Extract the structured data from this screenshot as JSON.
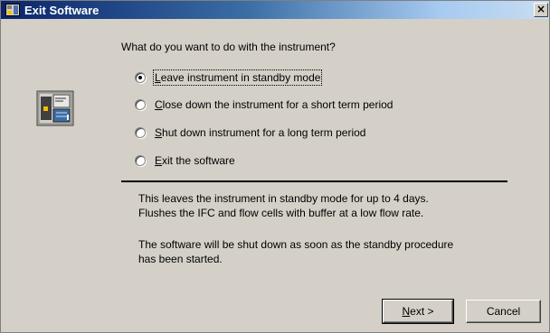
{
  "window": {
    "title": "Exit Software",
    "close_glyph": "×"
  },
  "prompt": "What do you want to do with the instrument?",
  "options": [
    {
      "hotkey": "L",
      "rest": "eave instrument in standby mode",
      "checked": true
    },
    {
      "hotkey": "C",
      "rest": "lose down the instrument for a short term period",
      "checked": false
    },
    {
      "hotkey": "S",
      "rest": "hut down instrument for a long term period",
      "checked": false
    },
    {
      "hotkey": "E",
      "rest": "xit the software",
      "checked": false
    }
  ],
  "description": {
    "line1": "This leaves the instrument in standby mode for up to 4 days.",
    "line2": "Flushes the IFC and flow cells with buffer at a low flow rate.",
    "line3": "The software will be shut down as soon as the standby procedure",
    "line4": "has been started."
  },
  "buttons": {
    "next_hotkey": "N",
    "next_rest": "ext >",
    "cancel": "Cancel"
  },
  "icons": {
    "title": "app-window-icon",
    "instrument": "instrument-icon"
  }
}
